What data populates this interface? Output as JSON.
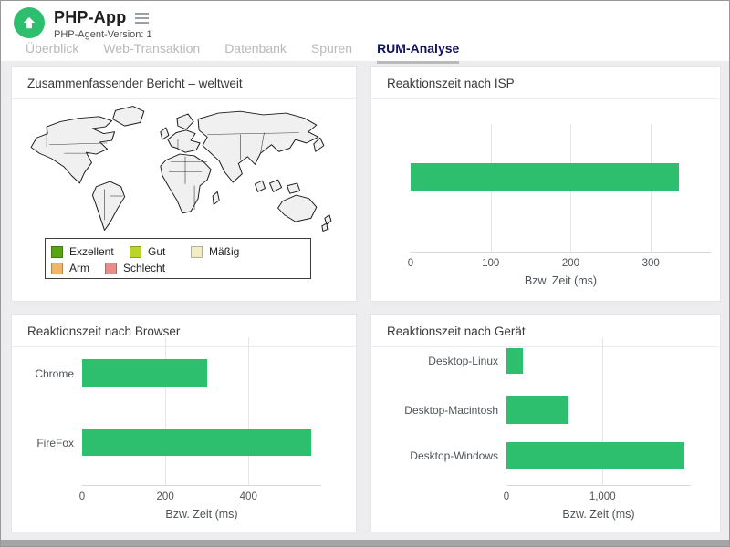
{
  "header": {
    "title": "PHP-App",
    "subtitle": "PHP-Agent-Version: 1",
    "logo_icon": "up-arrow-icon",
    "menu_icon": "hamburger-icon",
    "logo_color": "#2dbe6e"
  },
  "tabs": [
    {
      "label": "Überblick",
      "active": false
    },
    {
      "label": "Web-Transaktion",
      "active": false
    },
    {
      "label": "Datenbank",
      "active": false
    },
    {
      "label": "Spuren",
      "active": false
    },
    {
      "label": "RUM-Analyse",
      "active": true
    }
  ],
  "colors": {
    "bar_green": "#2dbe6e",
    "active_tab": "#10125c",
    "map_fill": "#f0f0f0",
    "map_stroke": "#1c1c1c"
  },
  "panels": {
    "map": {
      "title": "Zusammenfassender Bericht – weltweit",
      "legend": [
        {
          "label": "Exzellent",
          "color": "#58a514"
        },
        {
          "label": "Gut",
          "color": "#bbd428"
        },
        {
          "label": "Mäßig",
          "color": "#f1ecc3"
        },
        {
          "label": "Arm",
          "color": "#f2b566"
        },
        {
          "label": "Schlecht",
          "color": "#e88d88"
        }
      ]
    },
    "isp": {
      "title": "Reaktionszeit nach ISP"
    },
    "browser": {
      "title": "Reaktionszeit nach Browser"
    },
    "device": {
      "title": "Reaktionszeit nach Gerät"
    }
  },
  "chart_data": [
    {
      "id": "isp",
      "type": "bar",
      "orientation": "horizontal",
      "title": "Reaktionszeit nach ISP",
      "categories": [
        ""
      ],
      "values": [
        335
      ],
      "xlabel": "Bzw. Zeit (ms)",
      "ylabel": "",
      "xlim": [
        0,
        375
      ],
      "grid": true,
      "bar_color": "#2dbe6e",
      "ticks": [
        {
          "v": 0,
          "label": "0"
        },
        {
          "v": 100,
          "label": "100"
        },
        {
          "v": 200,
          "label": "200"
        },
        {
          "v": 300,
          "label": "300"
        }
      ],
      "gridlines": [
        100,
        200,
        300
      ]
    },
    {
      "id": "browser",
      "type": "bar",
      "orientation": "horizontal",
      "title": "Reaktionszeit nach Browser",
      "categories": [
        "Chrome",
        "FireFox"
      ],
      "values": [
        300,
        550
      ],
      "xlabel": "Bzw. Zeit (ms)",
      "ylabel": "",
      "xlim": [
        0,
        575
      ],
      "grid": true,
      "bar_color": "#2dbe6e",
      "ticks": [
        {
          "v": 0,
          "label": "0"
        },
        {
          "v": 200,
          "label": "200"
        },
        {
          "v": 400,
          "label": "400"
        }
      ],
      "gridlines": [
        200,
        400
      ]
    },
    {
      "id": "device",
      "type": "bar",
      "orientation": "horizontal",
      "title": "Reaktionszeit nach Gerät",
      "categories": [
        "Desktop-Linux",
        "Desktop-Macintosh",
        "Desktop-Windows"
      ],
      "values": [
        170,
        650,
        1850
      ],
      "xlabel": "Bzw. Zeit (ms)",
      "ylabel": "",
      "xlim": [
        0,
        1920
      ],
      "grid": true,
      "bar_color": "#2dbe6e",
      "ticks": [
        {
          "v": 0,
          "label": "0"
        },
        {
          "v": 1000,
          "label": "1,000"
        }
      ],
      "gridlines": [
        1000
      ]
    }
  ]
}
